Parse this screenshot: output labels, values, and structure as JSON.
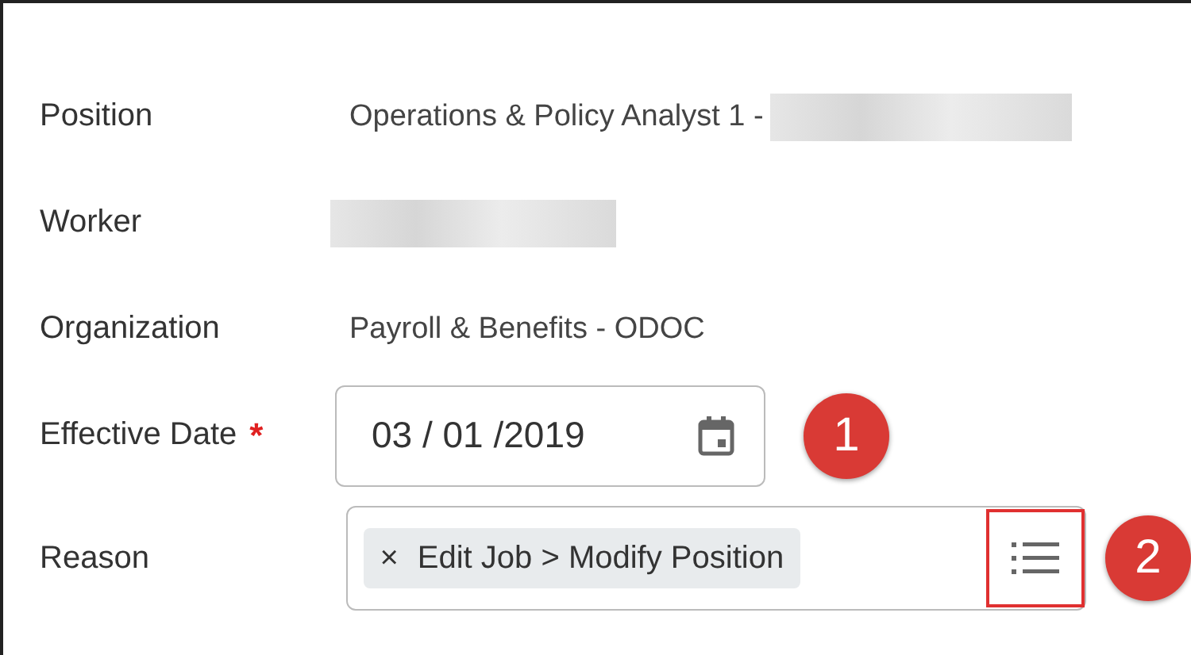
{
  "fields": [
    {
      "label": "Position",
      "kind": "text",
      "value": "Operations & Policy Analyst 1 -",
      "redacted": true
    },
    {
      "label": "Worker",
      "kind": "text",
      "redacted": true
    },
    {
      "label": "Organization",
      "kind": "text",
      "value": "Payroll & Benefits - ODOC"
    },
    {
      "label": "Effective Date",
      "kind": "date",
      "required_mark": "*",
      "value": "03 / 01 /2019",
      "callout": "1"
    },
    {
      "label": "Reason",
      "kind": "multiselect",
      "chips": [
        {
          "remove": "×",
          "text": "Edit Job > Modify Position"
        }
      ],
      "callout": "2",
      "highlighted": true
    }
  ]
}
